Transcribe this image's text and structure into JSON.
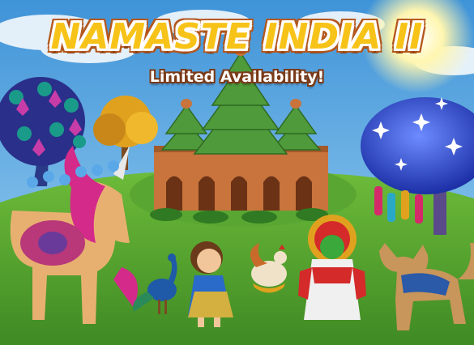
{
  "banner": {
    "title": "NAMASTE INDIA II",
    "subtitle": "Limited Availability!"
  },
  "colors": {
    "sky": "#5aa8e0",
    "grass": "#4c9a2c",
    "title_fill": "#f7c318",
    "title_outline": "#b4571d",
    "temple_roof": "#4f9a3a",
    "temple_wall": "#c8743c",
    "blue_tree": "#2a48c8",
    "unicorn_mane": "#d42a8a"
  },
  "scene_items": [
    {
      "name": "sun",
      "icon": "sun-icon"
    },
    {
      "name": "temple",
      "icon": "temple-icon"
    },
    {
      "name": "peacock-feather-tree",
      "icon": "tree-icon"
    },
    {
      "name": "orange-tree",
      "icon": "tree-icon"
    },
    {
      "name": "sparkling-blue-tree",
      "icon": "tree-icon"
    },
    {
      "name": "hanging-lanterns",
      "icon": "lantern-icon"
    },
    {
      "name": "jeweled-unicorn",
      "icon": "unicorn-icon"
    },
    {
      "name": "peacock",
      "icon": "peacock-icon"
    },
    {
      "name": "bharatanatyam-dancer",
      "icon": "dancer-icon"
    },
    {
      "name": "rooster",
      "icon": "rooster-icon"
    },
    {
      "name": "kathakali-dancer",
      "icon": "dancer-icon"
    },
    {
      "name": "decorated-lynx",
      "icon": "lynx-icon"
    }
  ]
}
